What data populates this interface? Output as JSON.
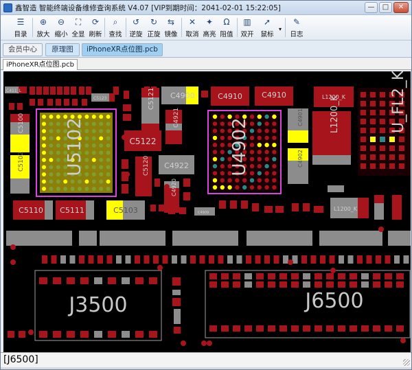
{
  "window": {
    "title": "鑫智造 智能终端设备维修查询系统 V4.07 [VIP到期时间：2041-02-01 15:22:05]",
    "controls": [
      "—",
      "□",
      "✕"
    ]
  },
  "toolbar": {
    "buttons": [
      {
        "id": "menu",
        "label": "目录",
        "icon": "list-icon",
        "glyph": "☰"
      },
      {
        "id": "zoom_in",
        "label": "放大",
        "icon": "zoom-in-icon",
        "glyph": "⊕"
      },
      {
        "id": "zoom_out",
        "label": "缩小",
        "icon": "zoom-out-icon",
        "glyph": "⊖"
      },
      {
        "id": "fit",
        "label": "全显",
        "icon": "fit-screen-icon",
        "glyph": "⛶"
      },
      {
        "id": "refresh",
        "label": "刷新",
        "icon": "refresh-icon",
        "glyph": "⟳"
      },
      {
        "id": "find",
        "label": "查找",
        "icon": "search-icon",
        "glyph": "⌕"
      },
      {
        "id": "rotate_ccw",
        "label": "逆旋",
        "icon": "rotate-left-icon",
        "glyph": "↺"
      },
      {
        "id": "rotate_cw",
        "label": "正旋",
        "icon": "rotate-right-icon",
        "glyph": "↻"
      },
      {
        "id": "mirror",
        "label": "镜像",
        "icon": "mirror-icon",
        "glyph": "⇆"
      },
      {
        "id": "cancel",
        "label": "取消",
        "icon": "cancel-icon",
        "glyph": "✕"
      },
      {
        "id": "highlight",
        "label": "高亮",
        "icon": "highlight-icon",
        "glyph": "✦"
      },
      {
        "id": "resistance",
        "label": "阻值",
        "icon": "resistance-icon",
        "glyph": "Ω"
      },
      {
        "id": "dual",
        "label": "双开",
        "icon": "dual-window-icon",
        "glyph": "▥"
      },
      {
        "id": "mouse",
        "label": "鼠标",
        "icon": "cursor-icon",
        "glyph": "➚"
      },
      {
        "id": "log",
        "label": "日志",
        "icon": "log-icon",
        "glyph": "✎"
      }
    ]
  },
  "tabs_top": [
    {
      "label": "会员中心",
      "state": "normal"
    },
    {
      "label": "原理图",
      "state": "blue"
    },
    {
      "label": "iPhoneXR点位图.pcb",
      "state": "active"
    }
  ],
  "doc_tab": {
    "label": "iPhoneXR点位图.pcb"
  },
  "board": {
    "colors": {
      "background": "#000000",
      "pad_red": "#a8141c",
      "pad_gray": "#8c8c8c",
      "pad_yellow": "#ffff00",
      "bga_gold": "#8c7f0a",
      "highlight": "#e040e0",
      "label": "#d0d0d0"
    },
    "components": [
      "U5102",
      "U4902",
      "C5121",
      "C5122",
      "C5120",
      "C4922",
      "C4921",
      "C4920",
      "C4900",
      "C4910",
      "C4910",
      "L1200_K",
      "L1200_K",
      "L1200_K",
      "U_FL2_K",
      "C5100",
      "C5101",
      "C5102",
      "C5110",
      "C5111",
      "C5123",
      "C5103",
      "C4909",
      "C4901",
      "C4902",
      "C411_L",
      "J3500",
      "J6500"
    ]
  },
  "status": {
    "text": "[J6500]"
  }
}
